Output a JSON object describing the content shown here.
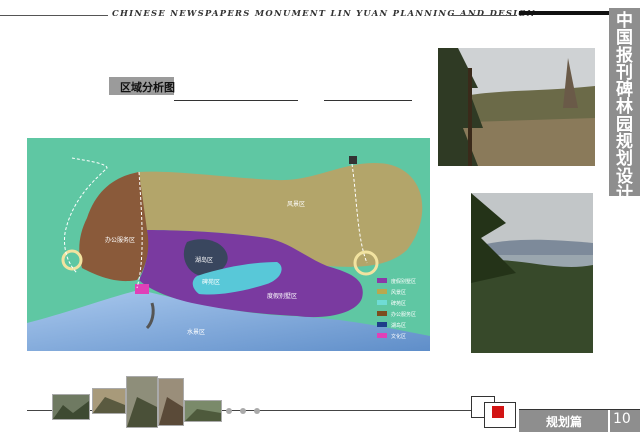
{
  "header": {
    "title": "CHINESE NEWSPAPERS MONUMENT LIN YUAN PLANNING AND DESIGN",
    "side_title": "中国报刊碑林园规划设计"
  },
  "section": {
    "label": "区域分析图"
  },
  "map": {
    "zones": [
      {
        "label": "风景区",
        "color": "#b3a56a"
      },
      {
        "label": "办公服务区",
        "color": "#8a5a3a"
      },
      {
        "label": "度假别墅区",
        "color": "#7a3aa0"
      },
      {
        "label": "湖岛区",
        "color": "#39465e"
      },
      {
        "label": "水景区",
        "color": "#7aa2d4"
      },
      {
        "label": "碑苑区",
        "color": "#58c8d8"
      }
    ],
    "legend": [
      {
        "label": "度假别墅区",
        "color": "#8a3aa8"
      },
      {
        "label": "风景区",
        "color": "#b9a84e"
      },
      {
        "label": "碑苑区",
        "color": "#6fdcd6"
      },
      {
        "label": "办公服务区",
        "color": "#7c4e1e"
      },
      {
        "label": "湖岛区",
        "color": "#1e3e8a"
      },
      {
        "label": "文化区",
        "color": "#e040b8"
      }
    ]
  },
  "footer": {
    "label": "规划篇",
    "page": "10"
  },
  "colors": {
    "accent_red": "#d21414",
    "band_gray": "#8e8e8e",
    "map_green": "#5fc7a3"
  }
}
